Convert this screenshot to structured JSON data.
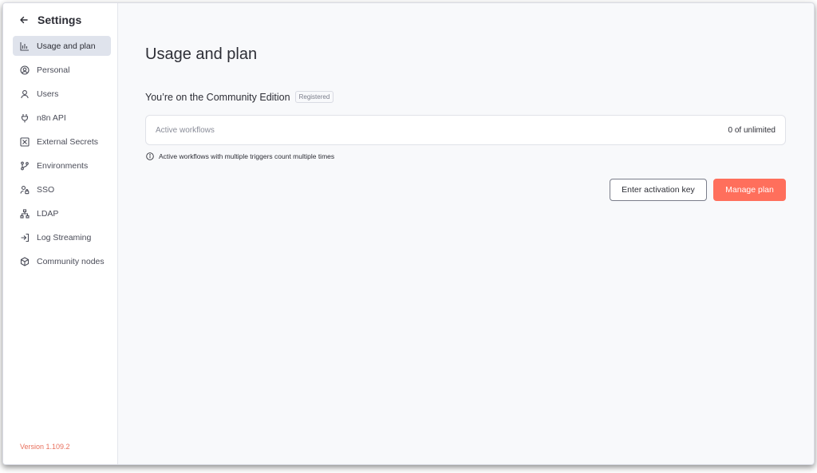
{
  "sidebar": {
    "title": "Settings",
    "items": [
      {
        "label": "Usage and plan",
        "icon": "bar-chart-icon",
        "active": true
      },
      {
        "label": "Personal",
        "icon": "user-circle-icon",
        "active": false
      },
      {
        "label": "Users",
        "icon": "user-icon",
        "active": false
      },
      {
        "label": "n8n API",
        "icon": "plug-icon",
        "active": false
      },
      {
        "label": "External Secrets",
        "icon": "vault-icon",
        "active": false
      },
      {
        "label": "Environments",
        "icon": "git-branch-icon",
        "active": false
      },
      {
        "label": "SSO",
        "icon": "user-lock-icon",
        "active": false
      },
      {
        "label": "LDAP",
        "icon": "network-icon",
        "active": false
      },
      {
        "label": "Log Streaming",
        "icon": "sign-in-icon",
        "active": false
      },
      {
        "label": "Community nodes",
        "icon": "cube-icon",
        "active": false
      }
    ],
    "version": "Version 1.109.2"
  },
  "main": {
    "title": "Usage and plan",
    "edition": "You’re on the Community Edition",
    "badge": "Registered",
    "usage": {
      "label": "Active workflows",
      "value": "0 of unlimited"
    },
    "info": "Active workflows with multiple triggers count multiple times",
    "buttons": {
      "activation": "Enter activation key",
      "manage": "Manage plan"
    }
  },
  "colors": {
    "accent": "#ff6f5c",
    "version": "#e8705d",
    "active_nav": "#dfe3ec"
  }
}
